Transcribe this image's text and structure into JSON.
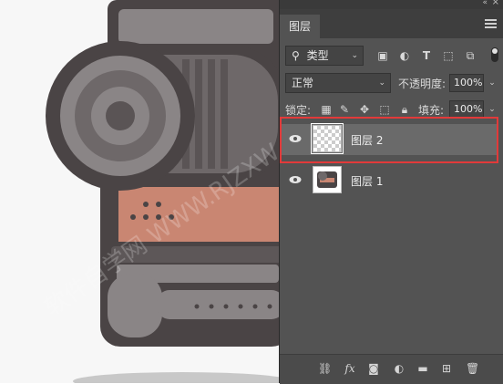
{
  "panel": {
    "tab_label": "图层",
    "collapse_icon": "«",
    "close_icon": "×"
  },
  "filter": {
    "kind_label": "类型",
    "icons": [
      "image-filter-icon",
      "adjustment-filter-icon",
      "type-filter-icon",
      "shape-filter-icon",
      "smart-object-filter-icon"
    ]
  },
  "blend": {
    "mode_label": "正常",
    "opacity_label": "不透明度:",
    "opacity_value": "100%"
  },
  "lock": {
    "label": "锁定:",
    "fill_label": "填充:",
    "fill_value": "100%"
  },
  "layers": [
    {
      "name": "图层 2",
      "selected": true,
      "thumbnail": "transparent"
    },
    {
      "name": "图层 1",
      "selected": false,
      "thumbnail": "camera-art"
    }
  ],
  "canvas": {
    "watermark": "软件自学网 WWW.RJZXW.COM"
  },
  "colors": {
    "panel_bg": "#535353",
    "selected_row": "#6a6a6a",
    "highlight_border": "#e23a3a",
    "camera_dark": "#4a4445",
    "camera_accent": "#c98672"
  }
}
